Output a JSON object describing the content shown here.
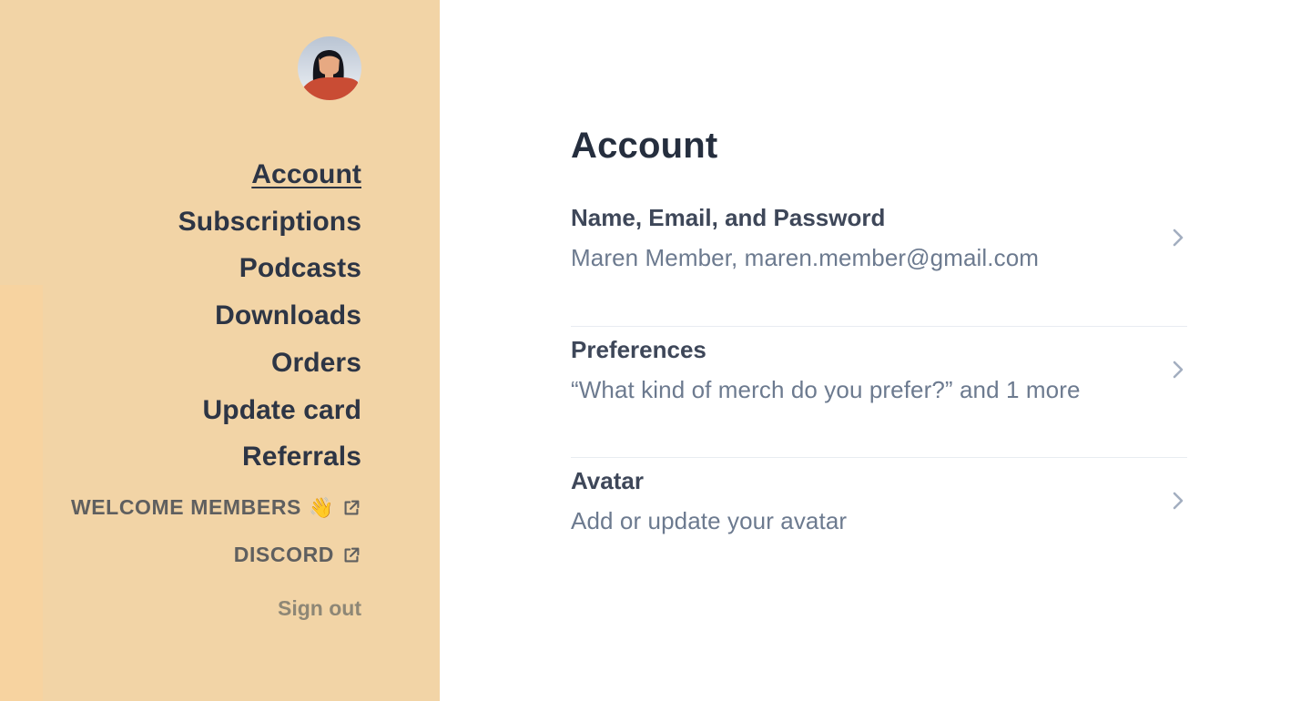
{
  "sidebar": {
    "avatar_label": "User avatar",
    "nav_items": [
      {
        "label": "Account",
        "active": true
      },
      {
        "label": "Subscriptions",
        "active": false
      },
      {
        "label": "Podcasts",
        "active": false
      },
      {
        "label": "Downloads",
        "active": false
      },
      {
        "label": "Orders",
        "active": false
      },
      {
        "label": "Update card",
        "active": false
      },
      {
        "label": "Referrals",
        "active": false
      }
    ],
    "external_links": [
      {
        "label": "WELCOME MEMBERS",
        "emoji": "👋",
        "icon": "external-link-icon"
      },
      {
        "label": "DISCORD",
        "icon": "external-link-icon"
      }
    ],
    "sign_out_label": "Sign out"
  },
  "main": {
    "title": "Account",
    "rows": [
      {
        "title": "Name, Email, and Password",
        "subtitle": "Maren Member, maren.member@gmail.com",
        "icon": "chevron-right-icon"
      },
      {
        "title": "Preferences",
        "subtitle": "“What kind of merch do you prefer?” and 1 more",
        "icon": "chevron-right-icon"
      },
      {
        "title": "Avatar",
        "subtitle": "Add or update your avatar",
        "icon": "chevron-right-icon"
      }
    ]
  },
  "colors": {
    "sidebar_bg": "#F2D4A6",
    "sidebar_strip": "#F7D3A0",
    "nav_text": "#2D3545",
    "ext_link_text": "#5F5F5F",
    "signout_text": "#8E8776",
    "title_text": "#252E3E",
    "row_title": "#3E4759",
    "row_subtitle": "#6C7A8F",
    "chevron": "#A3AEC0",
    "divider": "#E8ECF1"
  }
}
